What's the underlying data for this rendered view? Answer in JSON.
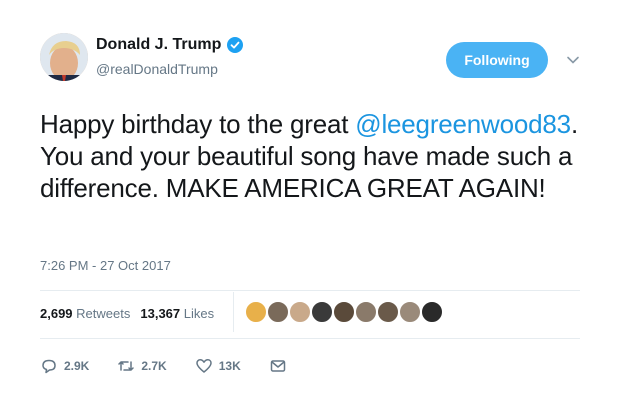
{
  "user": {
    "display_name": "Donald J. Trump",
    "handle": "@realDonaldTrump",
    "verified": true
  },
  "follow_button": {
    "label": "Following"
  },
  "tweet": {
    "text_before": "Happy birthday to the great ",
    "mention": "@leegreenwood83",
    "text_after": ". You and your beautiful song have made such a difference. MAKE AMERICA GREAT AGAIN!",
    "timestamp": "7:26 PM - 27 Oct 2017"
  },
  "stats": {
    "retweets_count": "2,699",
    "retweets_label": "Retweets",
    "likes_count": "13,367",
    "likes_label": "Likes"
  },
  "likers": [
    {
      "color": "#e8b04a"
    },
    {
      "color": "#7a6a5a"
    },
    {
      "color": "#c9a98a"
    },
    {
      "color": "#3a3a3a"
    },
    {
      "color": "#5a4a3a"
    },
    {
      "color": "#8a7a6a"
    },
    {
      "color": "#6a5a4a"
    },
    {
      "color": "#9a8a7a"
    },
    {
      "color": "#2a2a2a"
    }
  ],
  "actions": {
    "reply_count": "2.9K",
    "retweet_count": "2.7K",
    "like_count": "13K"
  },
  "colors": {
    "accent": "#1b95e0",
    "follow_bg": "#4ab3f4",
    "muted": "#657786"
  }
}
